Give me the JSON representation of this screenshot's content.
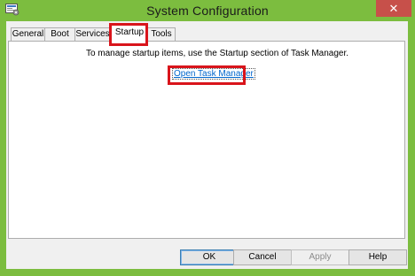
{
  "window": {
    "title": "System Configuration",
    "close_glyph": "✕",
    "frame_color": "#7cbd3f"
  },
  "tabs": [
    {
      "label": "General",
      "selected": false
    },
    {
      "label": "Boot",
      "selected": false
    },
    {
      "label": "Services",
      "selected": false
    },
    {
      "label": "Startup",
      "selected": true
    },
    {
      "label": "Tools",
      "selected": false
    }
  ],
  "startup_panel": {
    "message": "To manage startup items, use the Startup section of Task Manager.",
    "link_label": "Open Task Manager"
  },
  "buttons": {
    "ok": "OK",
    "cancel": "Cancel",
    "apply": "Apply",
    "help": "Help"
  },
  "annotation_color": "#d9141b"
}
